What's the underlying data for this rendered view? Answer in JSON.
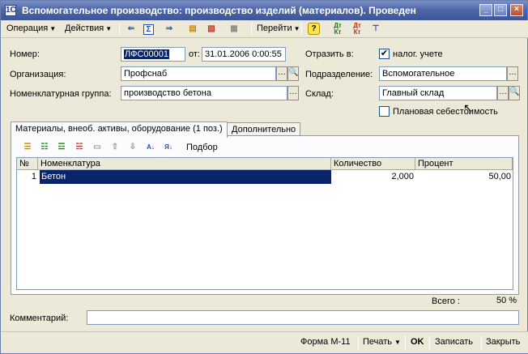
{
  "window": {
    "title": "Вспомогательное производство: производство изделий (материалов). Проведен",
    "app_icon": "1С"
  },
  "toolbar": {
    "operation_label": "Операция",
    "actions_label": "Действия",
    "goto_label": "Перейти",
    "help_label": "?",
    "dt_kt_label": "Дт Кт",
    "dtn_kt_label": "Дт Кт"
  },
  "header": {
    "number_label": "Номер:",
    "number_value": "ЛФС00001",
    "date_label": "от:",
    "date_value": "31.01.2006  0:00:55",
    "reflect_label": "Отразить в:",
    "tax_accounting_label": "налог. учете",
    "tax_accounting_checked": true,
    "organization_label": "Организация:",
    "organization_value": "Профснаб",
    "division_label": "Подразделение:",
    "division_value": "Вспомогательное",
    "nomenclature_group_label": "Номенклатурная группа:",
    "nomenclature_group_value": "производство бетона",
    "warehouse_label": "Склад:",
    "warehouse_value": "Главный склад",
    "planned_cost_label": "Плановая себестоимость",
    "planned_cost_checked": false
  },
  "tabs": [
    {
      "label": "Материалы, внеоб. активы, оборудование (1 поз.)",
      "active": true
    },
    {
      "label": "Дополнительно",
      "active": false
    }
  ],
  "subtoolbar": {
    "selection_label": "Подбор"
  },
  "table": {
    "columns": [
      "№",
      "Номенклатура",
      "Количество",
      "Процент"
    ],
    "rows": [
      {
        "num": "1",
        "nomenclature": "Бетон",
        "quantity": "2,000",
        "percent": "50,00"
      }
    ]
  },
  "totals": {
    "total_label": "Всего :",
    "total_value": "50 %"
  },
  "comment": {
    "label": "Комментарий:",
    "value": ""
  },
  "bottom": {
    "form_label": "Форма М-11",
    "print_label": "Печать",
    "ok_label": "OK",
    "save_label": "Записать",
    "close_label": "Закрыть"
  }
}
